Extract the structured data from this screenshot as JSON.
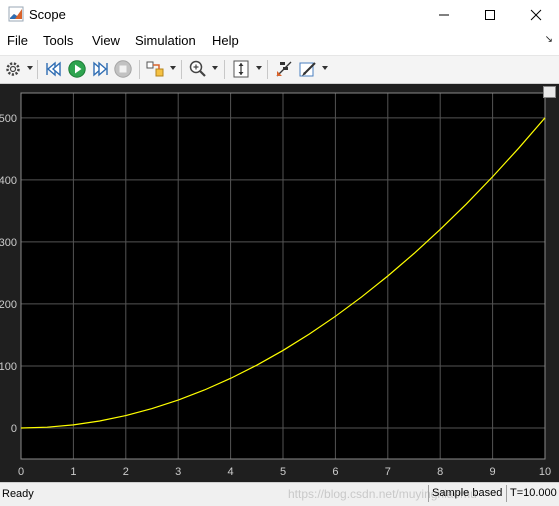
{
  "window": {
    "title": "Scope"
  },
  "menu": {
    "items": [
      "File",
      "Tools",
      "View",
      "Simulation",
      "Help"
    ]
  },
  "toolbar": {
    "buttons": [
      {
        "name": "settings-icon",
        "caret": true
      },
      {
        "name": "step-back-icon"
      },
      {
        "name": "run-icon"
      },
      {
        "name": "step-forward-icon"
      },
      {
        "name": "stop-icon"
      },
      {
        "name": "highlight-block-icon",
        "caret": true
      },
      {
        "name": "zoom-icon",
        "caret": true
      },
      {
        "name": "autoscale-icon",
        "caret": true
      },
      {
        "name": "cursor-measure-icon"
      },
      {
        "name": "style-icon",
        "caret": true
      }
    ]
  },
  "colors": {
    "plot_bg": "#000000",
    "axes_bg": "#1f1f1f",
    "grid": "#545454",
    "line": "#ffff00",
    "tick_text": "#cccccc"
  },
  "chart_data": {
    "type": "line",
    "title": "",
    "xlabel": "",
    "ylabel": "",
    "xlim": [
      0,
      10
    ],
    "ylim": [
      -50,
      540
    ],
    "xticks": [
      0,
      1,
      2,
      3,
      4,
      5,
      6,
      7,
      8,
      9,
      10
    ],
    "yticks": [
      0,
      100,
      200,
      300,
      400,
      500
    ],
    "grid": true,
    "series": [
      {
        "x": [
          0,
          0.5,
          1,
          1.5,
          2,
          2.5,
          3,
          3.5,
          4,
          4.5,
          5,
          5.5,
          6,
          6.5,
          7,
          7.5,
          8,
          8.5,
          9,
          9.5,
          10
        ],
        "y": [
          0,
          1.25,
          5,
          11.25,
          20,
          31.25,
          45,
          61.25,
          80,
          101.25,
          125,
          151.25,
          180,
          211.25,
          245,
          281.25,
          320,
          361.25,
          405,
          451.25,
          500
        ]
      }
    ]
  },
  "status": {
    "ready": "Ready",
    "watermark": "https://blog.csdn.net/muyingniaomu",
    "sample": "Sample based",
    "time": "T=10.000"
  }
}
